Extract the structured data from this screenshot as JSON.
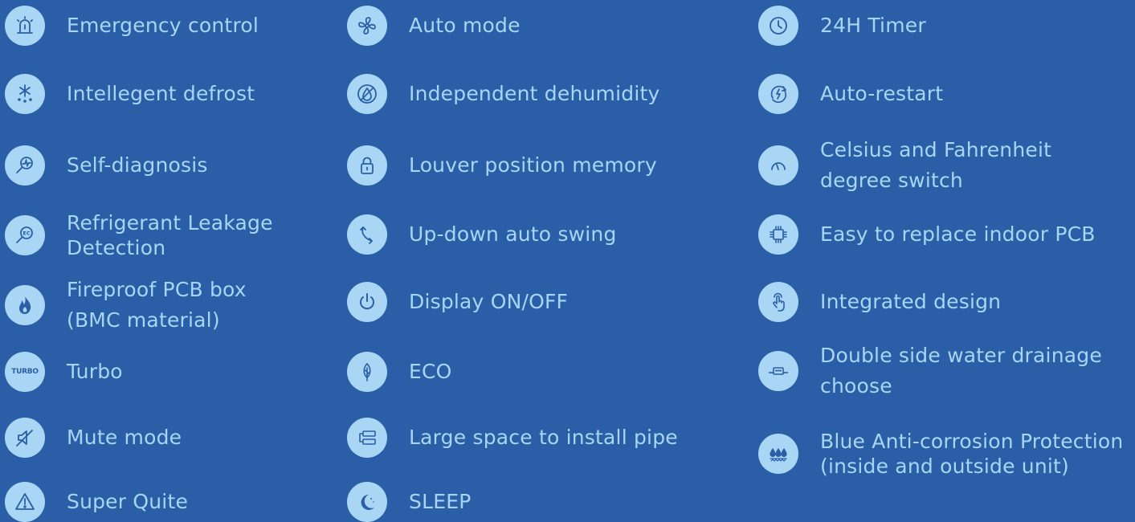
{
  "colors": {
    "background": "#2a5fa8",
    "text": "#a8d5f7",
    "icon_fill": "#a9d6f5"
  },
  "columns": [
    {
      "items": [
        {
          "label": "Emergency control",
          "icon": "siren-icon"
        },
        {
          "label": "Intellegent defrost",
          "icon": "snowflake-icon"
        },
        {
          "label": "Self-diagnosis",
          "icon": "magnifier-pulse-icon"
        },
        {
          "label": "Refrigerant Leakage\nDetection",
          "icon": "ec-magnifier-icon"
        },
        {
          "label": "Fireproof PCB box\n(BMC material)",
          "icon": "flame-icon"
        },
        {
          "label": "Turbo",
          "icon": "turbo-icon",
          "icon_text": "TURBO"
        },
        {
          "label": "Mute mode",
          "icon": "mute-speaker-icon"
        },
        {
          "label": "Super Quite",
          "icon": "warning-triangle-icon"
        }
      ]
    },
    {
      "items": [
        {
          "label": "Auto mode",
          "icon": "fan-icon"
        },
        {
          "label": "Independent dehumidity",
          "icon": "no-drop-icon"
        },
        {
          "label": "Louver position memory",
          "icon": "lock-icon"
        },
        {
          "label": "Up-down auto swing",
          "icon": "swing-arrow-icon"
        },
        {
          "label": "Display ON/OFF",
          "icon": "power-icon"
        },
        {
          "label": "ECO",
          "icon": "leaf-icon"
        },
        {
          "label": "Large space to install pipe",
          "icon": "pipe-unit-icon"
        },
        {
          "label": "SLEEP",
          "icon": "moon-icon"
        }
      ]
    },
    {
      "items": [
        {
          "label": "24H Timer",
          "icon": "clock-icon"
        },
        {
          "label": "Auto-restart",
          "icon": "restart-bolt-icon"
        },
        {
          "label": "Celsius and Fahrenheit\ndegree switch",
          "icon": "gauge-icon"
        },
        {
          "label": "Easy to replace indoor PCB",
          "icon": "chip-icon"
        },
        {
          "label": "Integrated design",
          "icon": "touch-hand-icon"
        },
        {
          "label": "Double side water drainage\nchoose",
          "icon": "drain-unit-icon"
        },
        {
          "label": "Blue Anti-corrosion Protection\n(inside and outside unit)",
          "icon": "droplets-icon"
        }
      ]
    }
  ]
}
